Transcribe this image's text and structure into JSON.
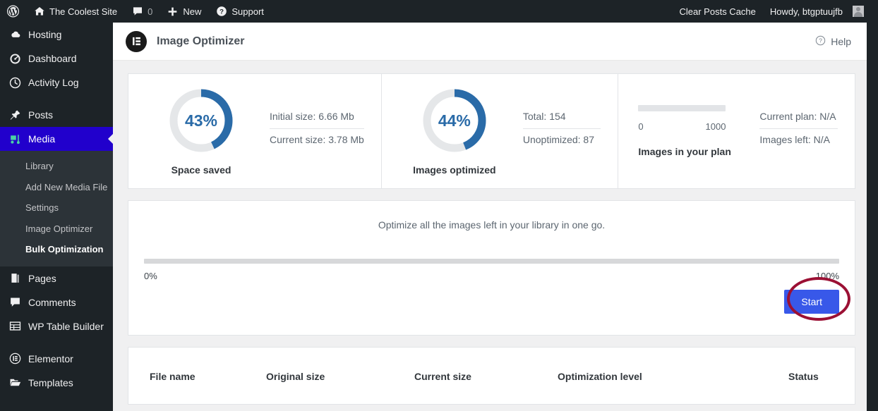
{
  "adminbar": {
    "wp_logo": "wordpress-logo",
    "site_name": "The Coolest Site",
    "comments_count": "0",
    "new_label": "New",
    "support_label": "Support",
    "clear_cache_label": "Clear Posts Cache",
    "howdy": "Howdy, btgptuujfb"
  },
  "sidebar": {
    "items": [
      {
        "label": "Hosting",
        "icon": "cloud-icon",
        "current": false
      },
      {
        "label": "Dashboard",
        "icon": "dashboard-icon",
        "current": false
      },
      {
        "label": "Activity Log",
        "icon": "clock-icon",
        "current": false
      },
      {
        "label": "Posts",
        "icon": "pin-icon",
        "current": false
      },
      {
        "label": "Media",
        "icon": "media-icon",
        "current": true
      },
      {
        "label": "Pages",
        "icon": "pages-icon",
        "current": false
      },
      {
        "label": "Comments",
        "icon": "comment-icon",
        "current": false
      },
      {
        "label": "WP Table Builder",
        "icon": "table-icon",
        "current": false
      },
      {
        "label": "Elementor",
        "icon": "elementor-icon",
        "current": false
      },
      {
        "label": "Templates",
        "icon": "folder-icon",
        "current": false
      }
    ],
    "submenu": [
      {
        "label": "Library",
        "active": false
      },
      {
        "label": "Add New Media File",
        "active": false
      },
      {
        "label": "Settings",
        "active": false
      },
      {
        "label": "Image Optimizer",
        "active": false
      },
      {
        "label": "Bulk Optimization",
        "active": true
      }
    ]
  },
  "header": {
    "title": "Image Optimizer",
    "logo": "elementor-logo",
    "help_label": "Help",
    "help_icon": "question-circle-icon"
  },
  "stats": {
    "space_saved": {
      "percent": 43,
      "percent_label": "43%",
      "caption": "Space saved",
      "line1": "Initial size: 6.66 Mb",
      "line2": "Current size: 3.78 Mb"
    },
    "images_optimized": {
      "percent": 44,
      "percent_label": "44%",
      "caption": "Images optimized",
      "line1": "Total: 154",
      "line2": "Unoptimized: 87"
    },
    "plan": {
      "caption": "Images in your plan",
      "scale_min": "0",
      "scale_max": "1000",
      "line1": "Current plan: N/A",
      "line2": "Images left: N/A"
    }
  },
  "bulk": {
    "description": "Optimize all the images left in your library in one go.",
    "progress_percent": 0,
    "progress_min_label": "0%",
    "progress_max_label": "100%",
    "start_label": "Start"
  },
  "table": {
    "columns": [
      "File name",
      "Original size",
      "Current size",
      "Optimization level",
      "Status"
    ],
    "rows": []
  },
  "colors": {
    "donut_arc": "#2a6ba8",
    "donut_track": "#e5e7e9",
    "start_button": "#3858e9",
    "annotation": "#9b1034",
    "sidebar_current": "#2100cc"
  }
}
